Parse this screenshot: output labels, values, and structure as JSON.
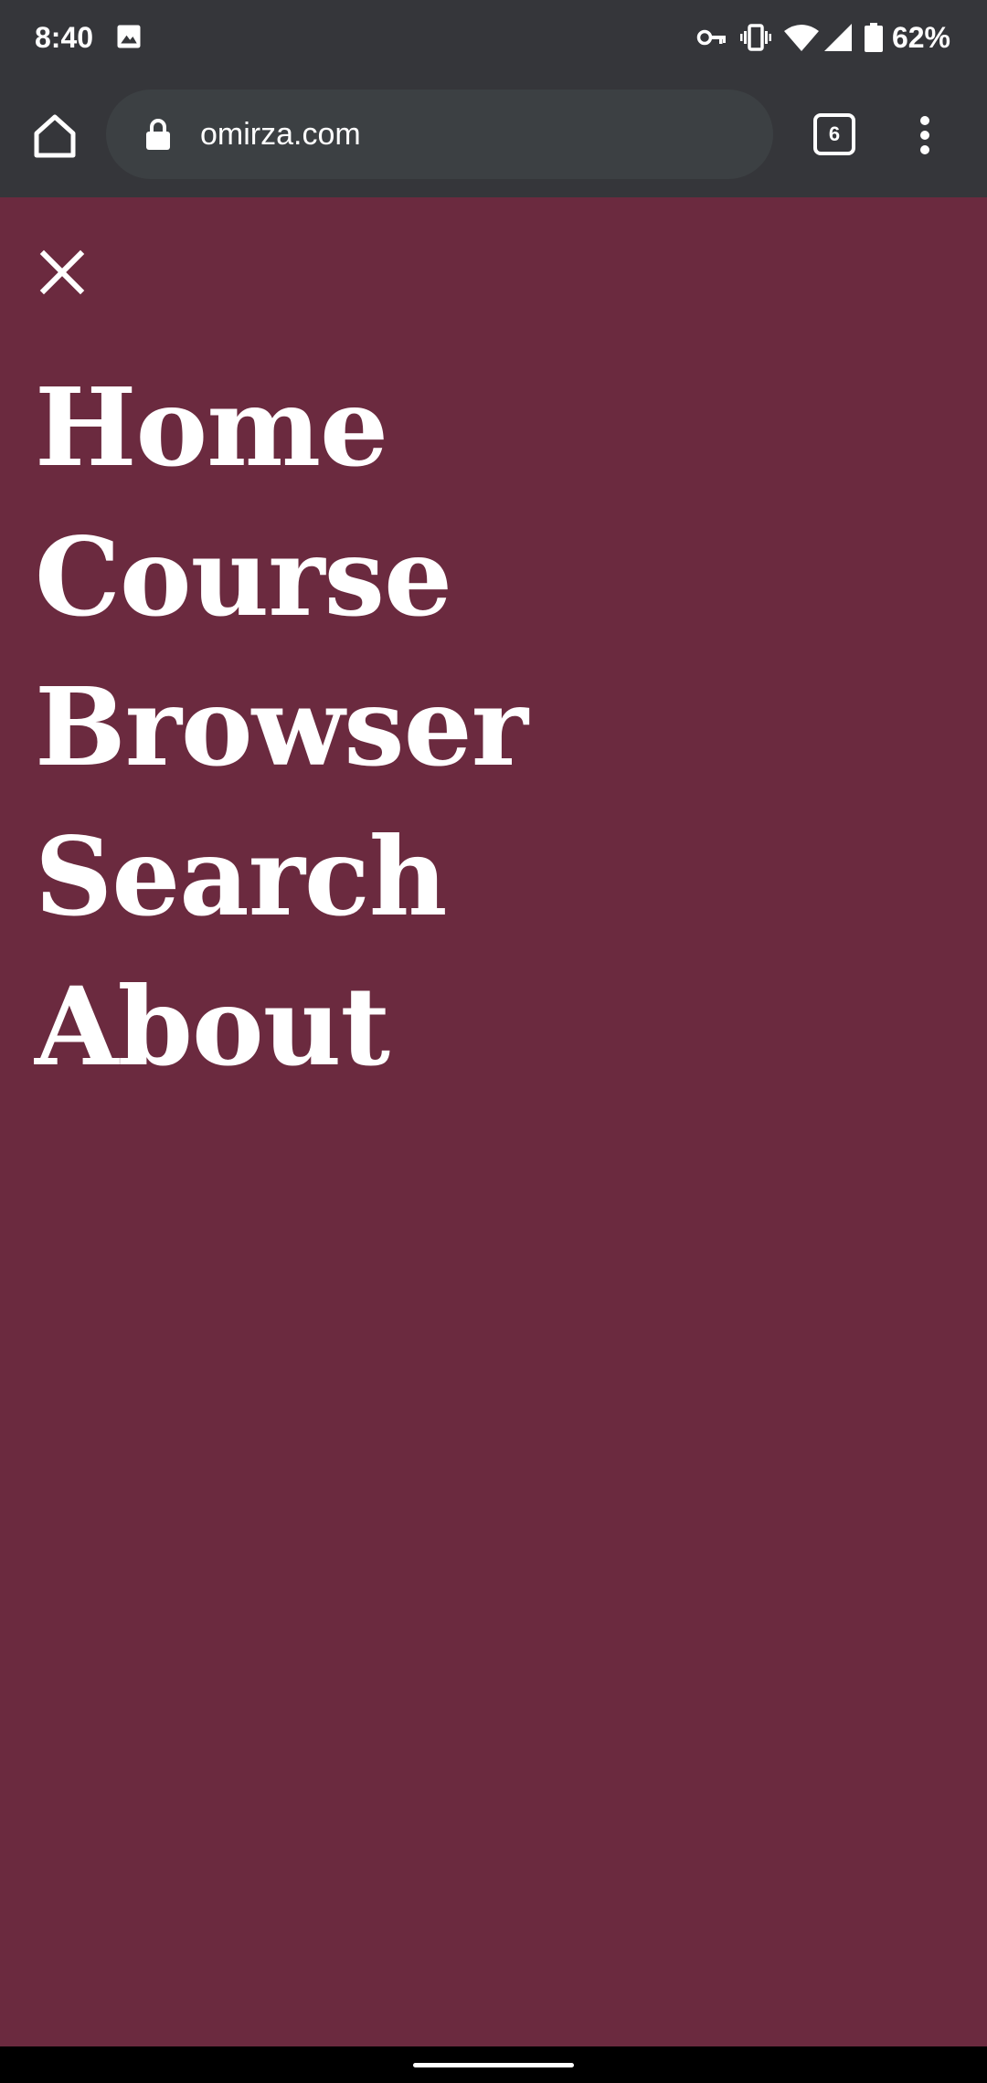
{
  "status_bar": {
    "time": "8:40",
    "battery": "62%",
    "icons": [
      "gallery-icon",
      "key-icon",
      "vibrate-icon",
      "wifi-icon",
      "signal-icon",
      "battery-icon"
    ]
  },
  "browser": {
    "url": "omirza.com",
    "tab_count": "6",
    "icons": [
      "home-icon",
      "lock-icon",
      "overflow-menu-icon"
    ]
  },
  "menu": {
    "close_icon": "close-icon",
    "items": [
      {
        "label": "Home"
      },
      {
        "label": "Course"
      },
      {
        "label": "Browser"
      },
      {
        "label": "Search"
      },
      {
        "label": "About"
      }
    ]
  },
  "colors": {
    "chrome_bg": "#35363a",
    "url_bar_bg": "#3c4043",
    "page_bg": "#6b2a3f",
    "text": "#ffffff"
  }
}
